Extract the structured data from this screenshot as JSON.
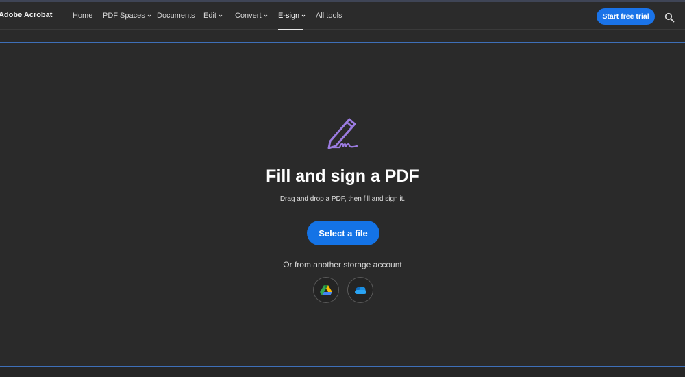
{
  "header": {
    "logo_text": "Adobe Acrobat",
    "nav": [
      {
        "label": "Home",
        "has_dropdown": false
      },
      {
        "label": "PDF Spaces",
        "has_dropdown": true
      },
      {
        "label": "Documents",
        "has_dropdown": false
      },
      {
        "label": "Edit",
        "has_dropdown": true
      },
      {
        "label": "Convert",
        "has_dropdown": true
      },
      {
        "label": "E-sign",
        "has_dropdown": true,
        "active": true
      },
      {
        "label": "All tools",
        "has_dropdown": false
      }
    ],
    "trial_button": "Start free trial",
    "search_icon": "search-icon"
  },
  "main": {
    "hero_icon": "pen-sign-icon",
    "title": "Fill and sign a PDF",
    "subtitle": "Drag and drop a PDF, then fill and sign it.",
    "select_button": "Select a file",
    "storage_text": "Or from another storage account",
    "storage_options": [
      {
        "icon": "google-drive-icon"
      },
      {
        "icon": "onedrive-icon"
      }
    ]
  },
  "colors": {
    "accent": "#1473e6",
    "background": "#2a2a2a",
    "rule": "#3e6fb8",
    "icon_purple": "#9b7be0"
  }
}
